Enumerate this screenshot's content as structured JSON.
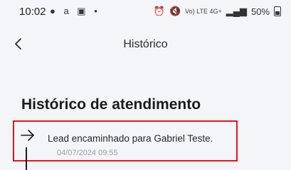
{
  "status_bar": {
    "time": "10:02",
    "left_icons": "● a ▣ •",
    "signal_text": "Vo) LTE 4G+",
    "battery": "50%"
  },
  "header": {
    "title": "Histórico"
  },
  "section": {
    "title": "Histórico de atendimento"
  },
  "history": [
    {
      "text": "Lead encaminhado para Gabriel Teste.",
      "datetime": "04/07/2024 09:55"
    }
  ],
  "icons": {
    "back": "chevron-left-icon",
    "history_item": "arrow-right-icon"
  },
  "colors": {
    "background": "#f4f5f8",
    "highlight_border": "#e4141d",
    "date_text": "#9c9da2"
  }
}
